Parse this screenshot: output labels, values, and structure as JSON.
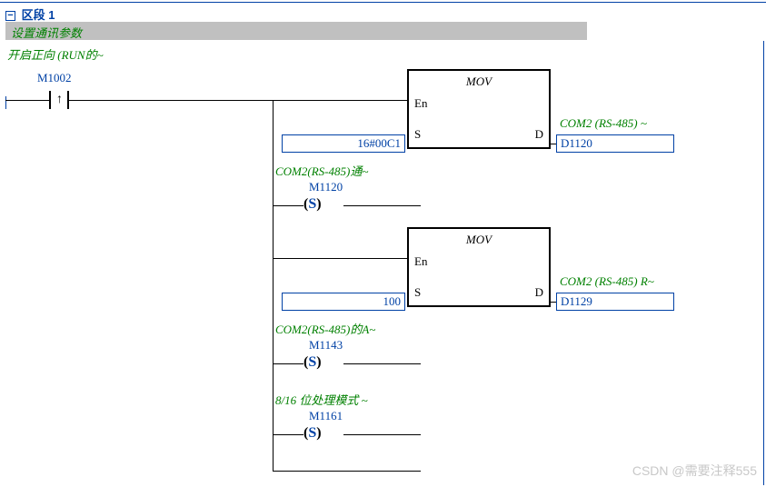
{
  "section": {
    "label": "区段 1",
    "comment": "设置通讯参数"
  },
  "contact": {
    "comment": "开启正向 (RUN的~",
    "address": "M1002",
    "type": "rising-pulse"
  },
  "mov1": {
    "title": "MOV",
    "en_label": "En",
    "s_label": "S",
    "d_label": "D",
    "source_value": "16#00C1",
    "dest_comment": "COM2 (RS-485) ~",
    "dest_addr": "D1120"
  },
  "coil1": {
    "comment": "COM2(RS-485)通~",
    "address": "M1120",
    "type": "S"
  },
  "mov2": {
    "title": "MOV",
    "en_label": "En",
    "s_label": "S",
    "d_label": "D",
    "source_value": "100",
    "dest_comment": "COM2 (RS-485) R~",
    "dest_addr": "D1129"
  },
  "coil2": {
    "comment": "COM2(RS-485)的A~",
    "address": "M1143",
    "type": "S"
  },
  "coil3": {
    "comment": "8/16 位处理模式 ~",
    "address": "M1161",
    "type": "S"
  },
  "watermark": "CSDN @需要注释555"
}
